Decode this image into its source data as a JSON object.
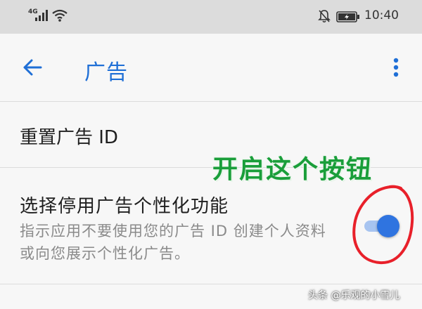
{
  "status_bar": {
    "network": "4G",
    "time": "10:40"
  },
  "app_bar": {
    "title": "广告",
    "accent_color": "#1f6fd6"
  },
  "settings": {
    "reset_label": "重置广告 ID",
    "opt_out_title": "选择停用广告个性化功能",
    "opt_out_description": "指示应用不要使用您的广告 ID 创建个人资料或向您展示个性化广告。",
    "opt_out_enabled": true
  },
  "annotation": {
    "text": "开启这个按钮",
    "color": "#1a9e3a",
    "circle_color": "#e8202a"
  },
  "watermark": "头条 @乐观的小雪儿",
  "icons": {
    "back": "arrow-left-icon",
    "menu": "more-vert-icon",
    "signal": "signal-bars-icon",
    "wifi": "wifi-icon",
    "notifications_off": "bell-off-icon",
    "battery": "battery-icon"
  }
}
